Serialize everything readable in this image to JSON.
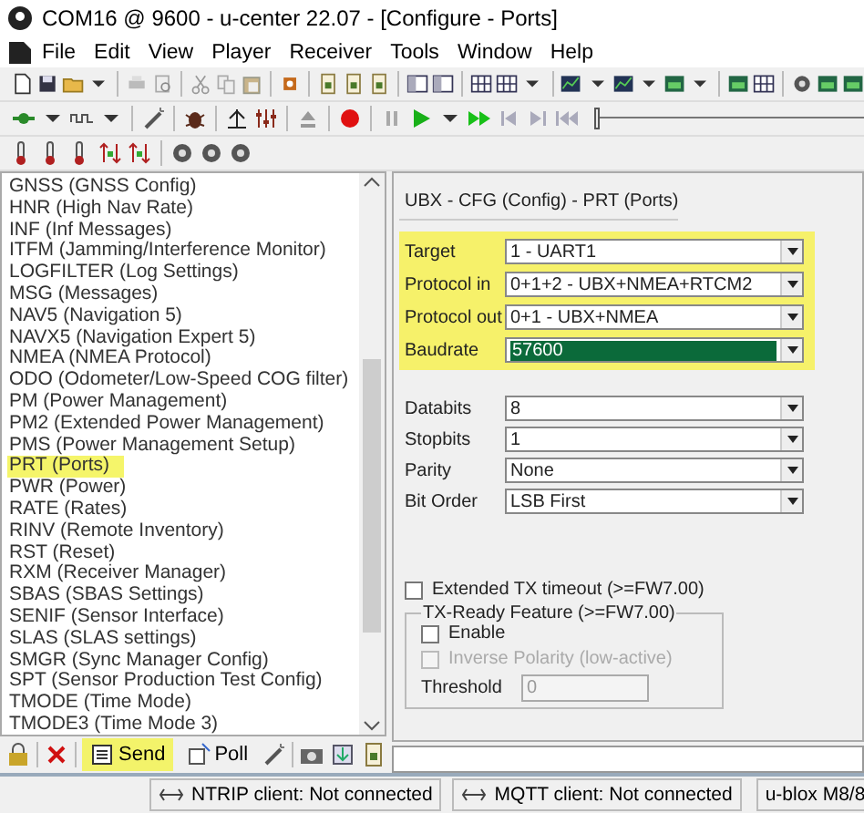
{
  "window": {
    "title": "COM16 @ 9600 - u-center 22.07 - [Configure - Ports]"
  },
  "menu": [
    "File",
    "Edit",
    "View",
    "Player",
    "Receiver",
    "Tools",
    "Window",
    "Help"
  ],
  "playback": {
    "level": 0
  },
  "messages": [
    {
      "label": "GNSS (GNSS Config)",
      "selected": false
    },
    {
      "label": "HNR (High Nav Rate)",
      "selected": false
    },
    {
      "label": "INF (Inf Messages)",
      "selected": false
    },
    {
      "label": "ITFM (Jamming/Interference Monitor)",
      "selected": false
    },
    {
      "label": "LOGFILTER (Log Settings)",
      "selected": false
    },
    {
      "label": "MSG (Messages)",
      "selected": false
    },
    {
      "label": "NAV5 (Navigation 5)",
      "selected": false
    },
    {
      "label": "NAVX5 (Navigation Expert 5)",
      "selected": false
    },
    {
      "label": "NMEA (NMEA Protocol)",
      "selected": false
    },
    {
      "label": "ODO (Odometer/Low-Speed COG filter)",
      "selected": false
    },
    {
      "label": "PM (Power Management)",
      "selected": false
    },
    {
      "label": "PM2 (Extended Power Management)",
      "selected": false
    },
    {
      "label": "PMS (Power Management Setup)",
      "selected": false
    },
    {
      "label": "PRT (Ports)",
      "selected": true
    },
    {
      "label": "PWR (Power)",
      "selected": false
    },
    {
      "label": "RATE (Rates)",
      "selected": false
    },
    {
      "label": "RINV (Remote Inventory)",
      "selected": false
    },
    {
      "label": "RST (Reset)",
      "selected": false
    },
    {
      "label": "RXM (Receiver Manager)",
      "selected": false
    },
    {
      "label": "SBAS (SBAS Settings)",
      "selected": false
    },
    {
      "label": "SENIF (Sensor Interface)",
      "selected": false
    },
    {
      "label": "SLAS (SLAS settings)",
      "selected": false
    },
    {
      "label": "SMGR (Sync Manager Config)",
      "selected": false
    },
    {
      "label": "SPT (Sensor Production Test Config)",
      "selected": false
    },
    {
      "label": "TMODE (Time Mode)",
      "selected": false
    },
    {
      "label": "TMODE3 (Time Mode 3)",
      "selected": false
    }
  ],
  "bottom_toolbar": {
    "send": "Send",
    "poll": "Poll"
  },
  "config": {
    "title": "UBX - CFG (Config) - PRT (Ports)",
    "highlighted_fields": [
      {
        "label": "Target",
        "value": "1 - UART1",
        "selected": false
      },
      {
        "label": "Protocol in",
        "value": "0+1+2 - UBX+NMEA+RTCM2",
        "selected": false
      },
      {
        "label": "Protocol out",
        "value": "0+1 - UBX+NMEA",
        "selected": false
      },
      {
        "label": "Baudrate",
        "value": "57600",
        "selected": true
      }
    ],
    "fields": [
      {
        "label": "Databits",
        "value": "8",
        "selected": false
      },
      {
        "label": "Stopbits",
        "value": "1",
        "selected": false
      },
      {
        "label": "Parity",
        "value": "None",
        "selected": false
      },
      {
        "label": "Bit Order",
        "value": "LSB First",
        "selected": false
      }
    ],
    "extended_timeout": {
      "label": "Extended TX timeout (>=FW7.00)",
      "checked": false
    },
    "tx_ready": {
      "title": "TX-Ready Feature (>=FW7.00)",
      "options": [
        {
          "label": "Enable",
          "checked": false,
          "disabled": false
        },
        {
          "label": "Inverse Polarity (low-active)",
          "checked": false,
          "disabled": true
        }
      ],
      "threshold": {
        "label": "Threshold",
        "value": "0",
        "disabled": true
      }
    }
  },
  "status_bar": [
    "NTRIP client: Not connected",
    "MQTT client: Not connected",
    "u-blox M8/8"
  ]
}
